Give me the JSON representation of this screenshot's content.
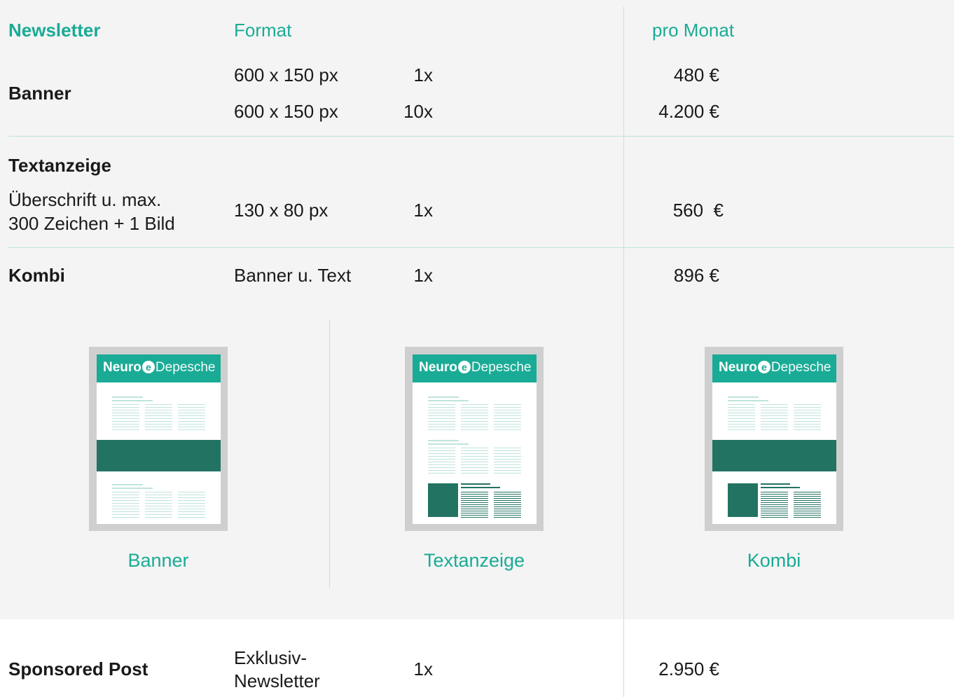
{
  "header": {
    "col_newsletter": "Newsletter",
    "col_format": "Format",
    "col_price": "pro Monat"
  },
  "rows": {
    "banner": {
      "name": "Banner",
      "lines": [
        {
          "format": "600 x 150 px",
          "qty": "1x",
          "price": "480 €"
        },
        {
          "format": "600 x 150 px",
          "qty": "10x",
          "price": "4.200 €"
        }
      ]
    },
    "textanzeige": {
      "name": "Textanzeige",
      "desc_line1": "Überschrift u. max.",
      "desc_line2": "300 Zeichen + 1 Bild",
      "format": "130 x 80 px",
      "qty": "1x",
      "price": "560  €"
    },
    "kombi": {
      "name": "Kombi",
      "format": "Banner u. Text",
      "qty": "1x",
      "price": "896 €"
    },
    "sponsored": {
      "name": "Sponsored Post",
      "format_line1": "Exklusiv-",
      "format_line2": "Newsletter",
      "qty": "1x",
      "price": "2.950 €"
    }
  },
  "mockups": {
    "logo_neuro": "Neuro",
    "logo_e": "e",
    "logo_depesche": "Depesche",
    "captions": [
      "Banner",
      "Textanzeige",
      "Kombi"
    ]
  },
  "colors": {
    "accent": "#1aab96",
    "dark_green": "#237363",
    "light_line": "#bfe3dd",
    "background": "#f4f4f4"
  }
}
